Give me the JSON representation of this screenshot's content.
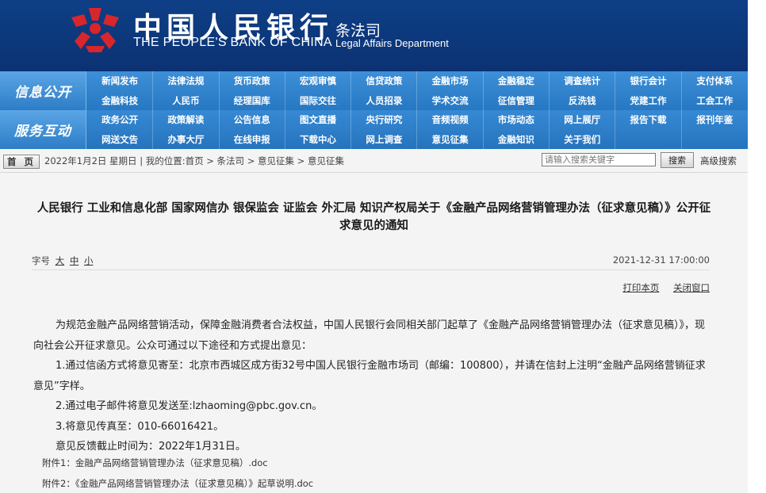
{
  "header": {
    "bank_cn": "中国人民银行",
    "bank_en": "THE PEOPLE'S BANK OF CHINA",
    "dept_cn": "条法司",
    "dept_en": "Legal Affairs Department"
  },
  "nav": {
    "row1": {
      "label": "信息公开",
      "items": [
        "新闻发布",
        "法律法规",
        "货币政策",
        "宏观审慎",
        "信贷政策",
        "金融市场",
        "金融稳定",
        "调查统计",
        "银行会计",
        "支付体系",
        "金融科技",
        "人民币",
        "经理国库",
        "国际交往",
        "人员招录",
        "学术交流",
        "征信管理",
        "反洗钱",
        "党建工作",
        "工会工作"
      ]
    },
    "row2": {
      "label": "服务互动",
      "items": [
        "政务公开",
        "政策解读",
        "公告信息",
        "图文直播",
        "央行研究",
        "音频视频",
        "市场动态",
        "网上展厅",
        "报告下载",
        "报刊年鉴",
        "网送文告",
        "办事大厅",
        "在线申报",
        "下载中心",
        "网上调查",
        "意见征集",
        "金融知识",
        "关于我们",
        "",
        ""
      ]
    }
  },
  "crumb": {
    "home": "首 页",
    "text": "2022年1月2日 星期日 | 我的位置:首页 > 条法司 > 意见征集 > 意见征集",
    "search_placeholder": "请输入搜索关键字",
    "search_button": "搜索",
    "advanced": "高级搜索"
  },
  "article": {
    "title_line1": "人民银行 工业和信息化部 国家网信办 银保监会 证监会 外汇局 知识产权局关于《金融产品网络营销管理办法（征求意见稿）》公开征",
    "title_line2": "求意见的通知",
    "fontsize_label": "字号",
    "fontsize_large": "大",
    "fontsize_medium": "中",
    "fontsize_small": "小",
    "date": "2021-12-31 17:00:00",
    "print": "打印本页",
    "close": "关闭窗口",
    "p1": "为规范金融产品网络营销活动，保障金融消费者合法权益，中国人民银行会同相关部门起草了《金融产品网络营销管理办法（征求意见稿）》，现向社会公开征求意见。公众可通过以下途径和方式提出意见：",
    "p2": "1.通过信函方式将意见寄至：北京市西城区成方街32号中国人民银行金融市场司（邮编：100800），并请在信封上注明“金融产品网络营销征求意见”字样。",
    "p3": "2.通过电子邮件将意见发送至:lzhaoming@pbc.gov.cn。",
    "p4": "3.将意见传真至：010-66016421。",
    "p5": "意见反馈截止时间为：2022年1月31日。",
    "attach1": "附件1：金融产品网络营销管理办法（征求意见稿）.doc",
    "attach2": "附件2：《金融产品网络营销管理办法（征求意见稿）》起草说明.doc"
  },
  "colors": {
    "header_bg": "#0e3f86",
    "nav_bg": "#2f80c8",
    "logo_red": "#d7262c"
  }
}
